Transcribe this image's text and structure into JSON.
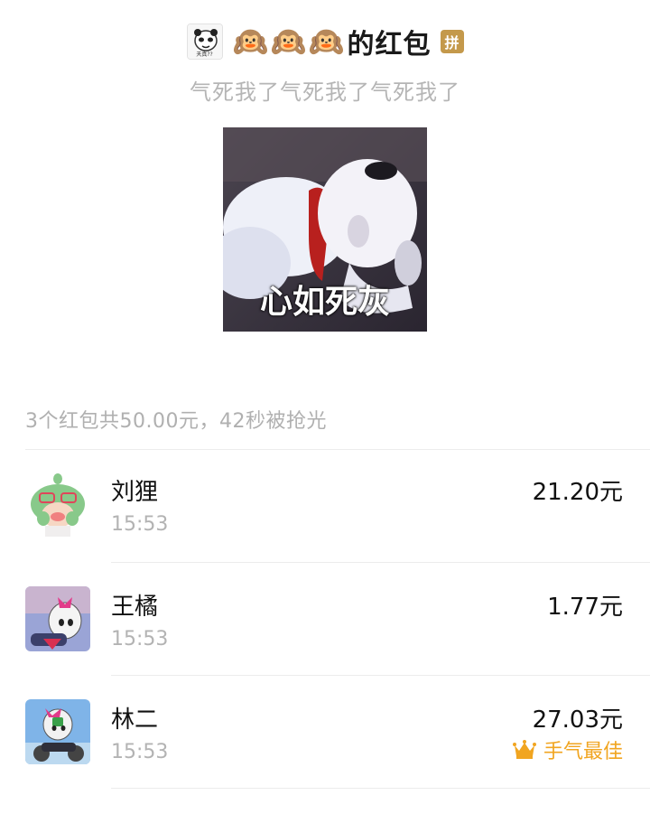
{
  "header": {
    "emoji": "🙉",
    "title": "的红包",
    "badge": "拼",
    "subtitle": "气死我了气死我了气死我了",
    "sender_avatar_text": "天真??"
  },
  "sticker": {
    "caption": "心如死灰"
  },
  "summary": "3个红包共50.00元，42秒被抢光",
  "recipients": [
    {
      "name": "刘狸",
      "time": "15:53",
      "amount": "21.20元"
    },
    {
      "name": "王橘",
      "time": "15:53",
      "amount": "1.77元"
    },
    {
      "name": "林二",
      "time": "15:53",
      "amount": "27.03元",
      "best_label": "手气最佳"
    }
  ],
  "colors": {
    "accent_gold": "#c4994b",
    "best_luck": "#f1a520",
    "muted_text": "#b3b3b3"
  },
  "icons": [
    "sender-avatar",
    "monkey-emoji",
    "crown-icon"
  ]
}
